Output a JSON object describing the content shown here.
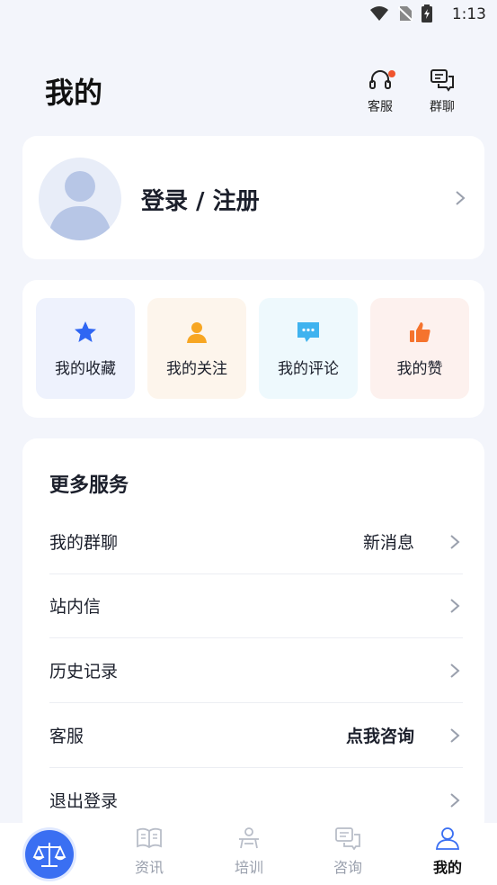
{
  "status_bar": {
    "time": "1:13"
  },
  "header": {
    "title": "我的",
    "customer_service_label": "客服",
    "group_chat_label": "群聊"
  },
  "profile": {
    "login_label": "登录 / 注册"
  },
  "quick_actions": [
    {
      "label": "我的收藏",
      "icon": "star-icon",
      "bg": "#eef2fd",
      "color": "#2f66f3"
    },
    {
      "label": "我的关注",
      "icon": "person-icon",
      "bg": "#fdf5ec",
      "color": "#f7a623"
    },
    {
      "label": "我的评论",
      "icon": "comment-icon",
      "bg": "#eef9fd",
      "color": "#3fb3ef"
    },
    {
      "label": "我的赞",
      "icon": "thumbs-up-icon",
      "bg": "#fdf1ee",
      "color": "#f5732d"
    }
  ],
  "more_services": {
    "title": "更多服务",
    "items": [
      {
        "label": "我的群聊",
        "value": "新消息"
      },
      {
        "label": "站内信",
        "value": ""
      },
      {
        "label": "历史记录",
        "value": ""
      },
      {
        "label": "客服",
        "value": "点我咨询"
      },
      {
        "label": "退出登录",
        "value": ""
      }
    ]
  },
  "tabbar": {
    "tabs": [
      {
        "label": "资讯"
      },
      {
        "label": "培训"
      },
      {
        "label": "咨询"
      },
      {
        "label": "我的"
      }
    ],
    "active": "我的"
  },
  "colors": {
    "accent": "#3a6ff2",
    "badge": "#f0542d",
    "background": "#f3f5fb"
  }
}
